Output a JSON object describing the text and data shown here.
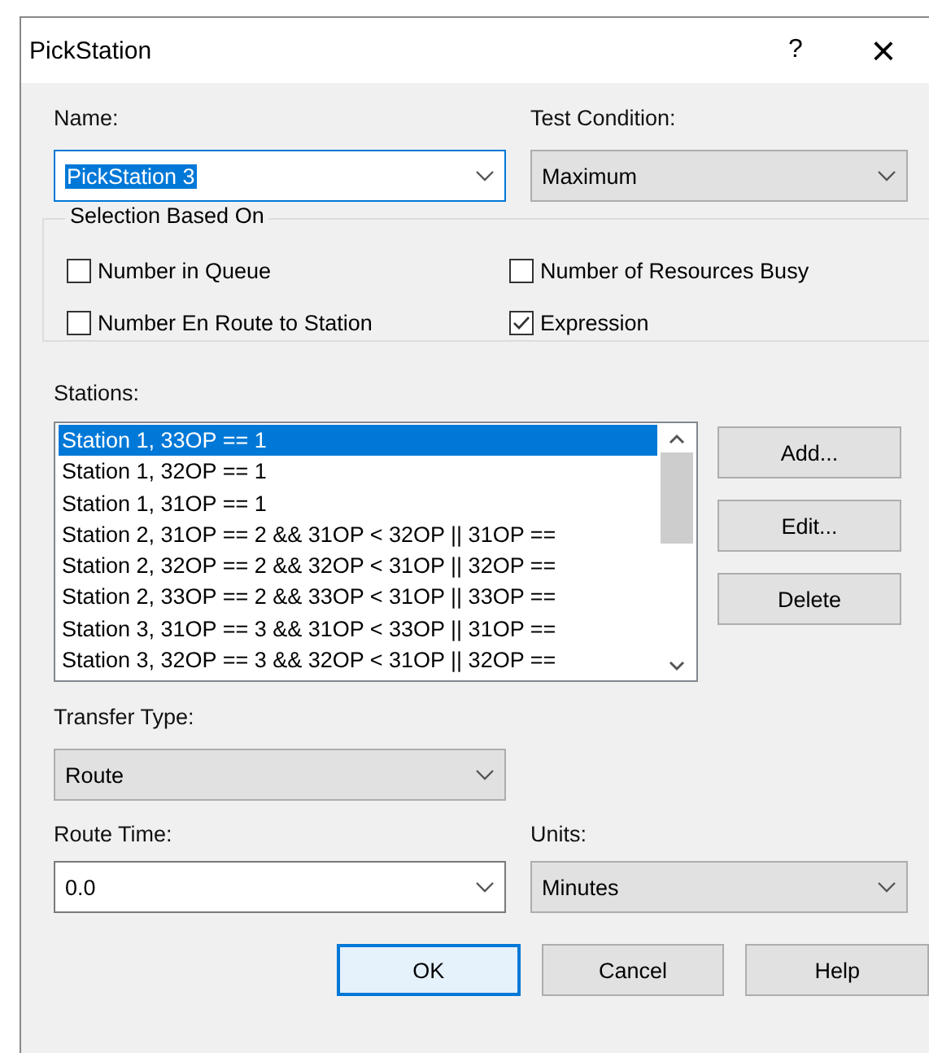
{
  "window": {
    "title": "PickStation",
    "help": "?",
    "close": "×"
  },
  "name": {
    "label": "Name:",
    "value": "PickStation 3",
    "focused": true
  },
  "test_condition": {
    "label": "Test Condition:",
    "value": "Maximum"
  },
  "selection": {
    "title": "Selection Based On",
    "options": [
      {
        "label": "Number in Queue",
        "checked": false
      },
      {
        "label": "Number of Resources Busy",
        "checked": false
      },
      {
        "label": "Number En Route to Station",
        "checked": false
      },
      {
        "label": "Expression",
        "checked": true
      }
    ]
  },
  "stations": {
    "label": "Stations:",
    "items": [
      {
        "text": "Station 1, 33OP == 1",
        "selected": true
      },
      {
        "text": "Station 1, 32OP == 1",
        "selected": false
      },
      {
        "text": "Station 1, 31OP == 1",
        "selected": false
      },
      {
        "text": "Station 2, 31OP == 2 && 31OP < 32OP || 31OP ==",
        "selected": false
      },
      {
        "text": "Station 2, 32OP == 2 && 32OP < 31OP || 32OP ==",
        "selected": false
      },
      {
        "text": "Station 2, 33OP == 2 && 33OP < 31OP || 33OP ==",
        "selected": false
      },
      {
        "text": "Station 3, 31OP == 3 && 31OP < 33OP || 31OP ==",
        "selected": false
      },
      {
        "text": "Station 3, 32OP == 3 && 32OP < 31OP || 32OP ==",
        "selected": false
      }
    ],
    "buttons": [
      "Add...",
      "Edit...",
      "Delete"
    ]
  },
  "transfer_type": {
    "label": "Transfer Type:",
    "value": "Route"
  },
  "route_time": {
    "label": "Route Time:",
    "value": "0.0"
  },
  "units": {
    "label": "Units:",
    "value": "Minutes"
  },
  "buttons": [
    {
      "label": "OK",
      "default": true
    },
    {
      "label": "Cancel",
      "default": false
    },
    {
      "label": "Help",
      "default": false
    }
  ]
}
